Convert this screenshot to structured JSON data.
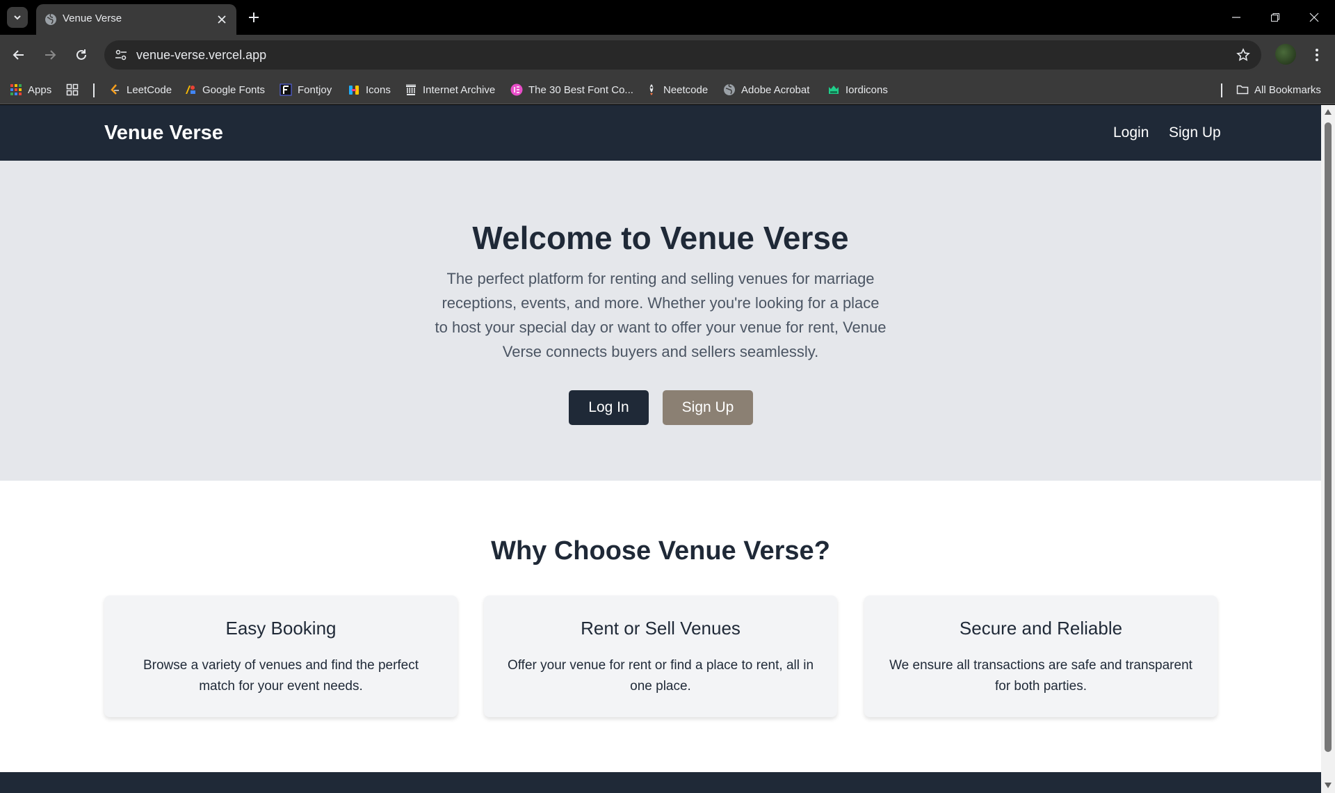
{
  "browser": {
    "tab_title": "Venue Verse",
    "url": "venue-verse.vercel.app",
    "bookmarks": [
      {
        "label": "Apps",
        "icon": "apps-grid-icon"
      },
      {
        "label": "LeetCode",
        "icon": "leetcode-icon"
      },
      {
        "label": "Google Fonts",
        "icon": "google-fonts-icon"
      },
      {
        "label": "Fontjoy",
        "icon": "fontjoy-icon"
      },
      {
        "label": "Icons",
        "icon": "icons8-icon"
      },
      {
        "label": "Internet Archive",
        "icon": "archive-icon"
      },
      {
        "label": "The 30 Best Font Co...",
        "icon": "font-collection-icon"
      },
      {
        "label": "Neetcode",
        "icon": "neetcode-icon"
      },
      {
        "label": "Adobe Acrobat",
        "icon": "adobe-icon"
      },
      {
        "label": "Iordicons",
        "icon": "iordicons-icon"
      }
    ],
    "all_bookmarks": "All Bookmarks"
  },
  "site": {
    "brand": "Venue Verse",
    "nav": {
      "login": "Login",
      "signup": "Sign Up"
    },
    "hero": {
      "title": "Welcome to Venue Verse",
      "text": "The perfect platform for renting and selling venues for marriage receptions, events, and more. Whether you're looking for a place to host your special day or want to offer your venue for rent, Venue Verse connects buyers and sellers seamlessly.",
      "login_btn": "Log In",
      "signup_btn": "Sign Up"
    },
    "features": {
      "title": "Why Choose Venue Verse?",
      "cards": [
        {
          "title": "Easy Booking",
          "text": "Browse a variety of venues and find the perfect match for your event needs."
        },
        {
          "title": "Rent or Sell Venues",
          "text": "Offer your venue for rent or find a place to rent, all in one place."
        },
        {
          "title": "Secure and Reliable",
          "text": "We ensure all transactions are safe and transparent for both parties."
        }
      ]
    }
  },
  "colors": {
    "nav_bg": "#1f2937",
    "hero_bg": "#e5e7eb",
    "signup_btn": "#8b8073"
  }
}
